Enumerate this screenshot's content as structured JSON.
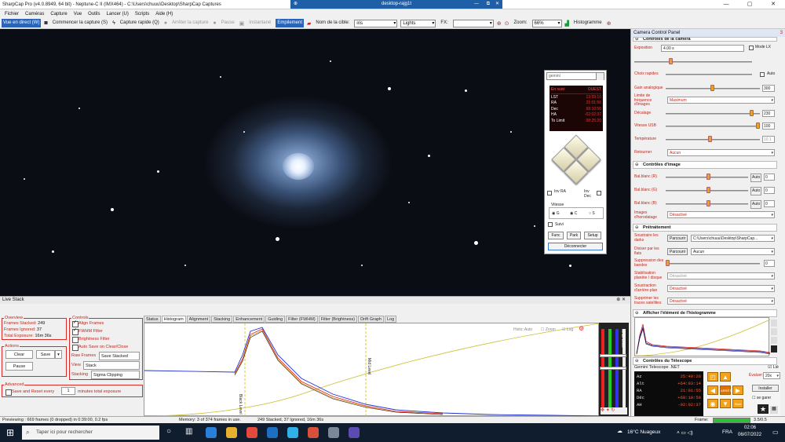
{
  "titlebar": {
    "title": "SharpCap Pro (v4.0.8949, 64 bit) - Neptune-C II (IMX464) - C:\\Users\\chuuu\\Desktop\\SharpCap Captures",
    "remote_title": "desktop-rajg1t",
    "min": "—",
    "max": "▢",
    "close": "✕"
  },
  "menu": [
    "Fichier",
    "Caméras",
    "Capture",
    "Vue",
    "Outils",
    "Lancer (U)",
    "Scripts",
    "Aide (H)"
  ],
  "toolbar": {
    "live": "Vue en direct (W)",
    "start": "Commencer la capture (S)",
    "quick": "Capture rapide (Q)",
    "stop": "Arrêter la capture",
    "pause": "Pause",
    "snapshot": "Instantané",
    "stack": "Empilement",
    "target_label": "Nom de la cible:",
    "target_value": "iris",
    "frame_type": "Lights",
    "fx_label": "FX:",
    "fx_value": "",
    "zoom_label": "Zoom:",
    "zoom_value": "66%",
    "histogram": "Histogramme"
  },
  "scope": {
    "input": "gemini",
    "status_head_l": "En suivi",
    "status_head_r": "OUEST",
    "rows": [
      {
        "k": "LST",
        "v": "13:59:10"
      },
      {
        "k": "RA",
        "v": "21:01:56"
      },
      {
        "k": "Dec",
        "v": "68:10:50"
      },
      {
        "k": "HA",
        "v": "-02:02:37"
      },
      {
        "k": "To Limit",
        "v": "08:25:20"
      }
    ],
    "inv_ra": "Inv RA",
    "inv_dec": "Inv Dec",
    "speed_label": "Vitesse",
    "speed_g": "G",
    "speed_c": "C",
    "speed_s": "S",
    "track": "Suivi",
    "func": "Func",
    "park": "Park",
    "setup": "Setup",
    "disconnect": "Déconnecter"
  },
  "rpanel": {
    "header": "Camera Control Panel",
    "badge": "3",
    "camera_section": "Contrôles de la caméra",
    "exposure_label": "Exposition",
    "exposure_value": "4.00 s",
    "lx_mode": "Mode LX",
    "quick_choice": "Choix rapides",
    "auto": "Auto",
    "gain_label": "Gain analogique",
    "gain_value": "300",
    "fps_limit_label": "Limite de fréquence d'images",
    "fps_limit_value": "Maximum",
    "offset_label": "Décalage",
    "offset_value": "230",
    "usb_label": "Vitesse USB",
    "usb_value": "100",
    "temp_label": "Température",
    "temp_value": "10.1",
    "flip_label": "Retourner",
    "flip_value": "Aucun",
    "image_section": "Contrôles d'image",
    "wb_r": "Bal.blanc (R)",
    "wb_r_value": "0",
    "wb_g": "Bal.blanc (G)",
    "wb_g_value": "0",
    "wb_b": "Bal.blanc (B)",
    "wb_b_value": "0",
    "timestamp_label": "Images d'horodatage",
    "timestamp_value": "Désactivé",
    "pre_section": "Prétraitement",
    "dark_label": "Soustraire les darks",
    "browse": "Parcourir",
    "dark_value": "C:\\Users\\chuuu\\Desktop\\SharpCap...",
    "flat_label": "Diviser par les flats",
    "flat_value": "Aucun",
    "banding_label": "Suppression des bandes",
    "banding_value": "0",
    "stab_label": "Stabilisation planète / disque",
    "stab_value": "Désactivé",
    "bg_label": "Soustraction d'arrière-plan",
    "bg_value": "Désactivé",
    "sat_label": "Supprimer les traces satellites",
    "sat_value": "Désactivé",
    "hist_section": "Afficher l'élément de l'histogramme",
    "tel_section": "Contrôles du Télescope",
    "tel_name": "Gemini Telescope .NET",
    "lie": "Lié",
    "tel_rows": [
      {
        "k": "Az",
        "v": "25:40:26"
      },
      {
        "k": "Alt",
        "v": "+64:03:14"
      },
      {
        "k": "RA",
        "v": "21:01:55"
      },
      {
        "k": "Déc",
        "v": "+68:10:50"
      },
      {
        "k": "AH",
        "v": "-02:02:37"
      }
    ],
    "eval_label": "Évaluer:",
    "eval_value": "20x",
    "install": "Installer",
    "park_label": "se garer",
    "stop": "ARRÊT",
    "save": "Save",
    "frame_label": "Frame:",
    "frame_value": "3.5/0.5"
  },
  "livestack": {
    "title": "Live Stack",
    "overview": "Overview",
    "frames_stacked_label": "Frames Stacked:",
    "frames_stacked": "249",
    "frames_ignored_label": "Frames Ignored:",
    "frames_ignored": "37",
    "total_exp_label": "Total Exposure:",
    "total_exp": "16m 36s",
    "controls": "Controls",
    "align": "Align Frames",
    "fwhm": "FWHM Filter",
    "bright": "Brightness Filter",
    "autosave": "Auto Save on Clear/Close",
    "raw_label": "Raw Frames",
    "raw_value": "Save Stacked",
    "view_label": "View",
    "view_value": "Stack",
    "stacking_label": "Stacking",
    "stacking_value": "Sigma Clipping",
    "actions": "Actions",
    "clear": "Clear",
    "save": "Save",
    "pause": "Pause",
    "advanced": "Advanced",
    "save_reset": "Save and Reset every",
    "save_reset_n": "1",
    "save_reset_unit": "minutes total exposure",
    "tabs": [
      "Status",
      "Histogram",
      "Alignment",
      "Stacking",
      "Enhancement",
      "Guiding",
      "Filter (FWHM)",
      "Filter (Brightness)",
      "Drift Graph",
      "Log"
    ],
    "hist_mode": "Histo: Auto",
    "zoom": "Zoom",
    "log": "Log",
    "black_level": "Black Level",
    "mid_level": "Mid Level",
    "white_level": "White Level"
  },
  "status": {
    "preview": "Previewing : 669 frames (0 dropped) in 0:39:00, 0.2 fps",
    "memory": "Memory: 3 of 374 frames in use.",
    "stacked": "249 Stacked, 37 Ignored, 16m 36s"
  },
  "taskbar": {
    "search": "Taper ici pour rechercher",
    "weather": "16°C Nuageux",
    "lang": "FRA",
    "time": "02:06",
    "date": "06/07/2022"
  }
}
